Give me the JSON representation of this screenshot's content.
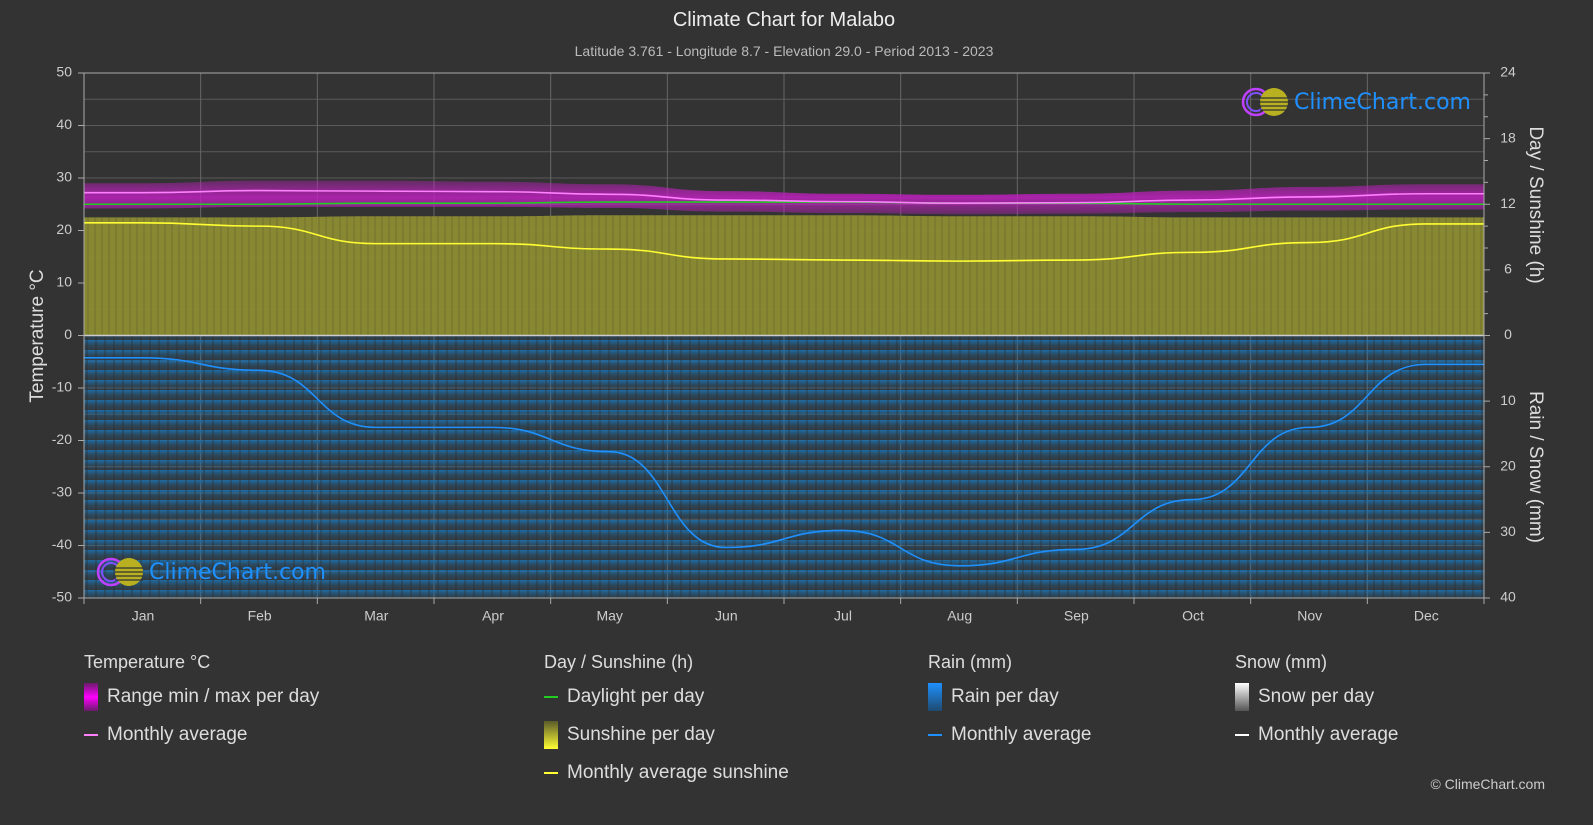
{
  "header": {
    "title": "Climate Chart for Malabo",
    "subtitle": "Latitude 3.761 - Longitude 8.7 - Elevation 29.0 - Period 2013 - 2023"
  },
  "logo": {
    "text": "ClimeChart.com"
  },
  "copyright": "© ClimeChart.com",
  "colors": {
    "background": "#333333",
    "temp_range": "#c020c0",
    "temp_avg": "#ff80ff",
    "daylight": "#22cc22",
    "sunshine_fill": "#8c8c33",
    "sunshine_avg": "#ffff33",
    "rain_fill": "#1e6ea8",
    "rain_avg": "#1e90ff",
    "snow_avg": "#ffffff",
    "brand": "#1e90ff"
  },
  "legend": {
    "temperature": {
      "title": "Temperature °C",
      "items": [
        {
          "label": "Range min / max per day",
          "icon": "range-swatch"
        },
        {
          "label": "Monthly average",
          "icon": "line-swatch"
        }
      ]
    },
    "sunshine": {
      "title": "Day / Sunshine (h)",
      "items": [
        {
          "label": "Daylight per day",
          "icon": "line-swatch"
        },
        {
          "label": "Sunshine per day",
          "icon": "bar-swatch"
        },
        {
          "label": "Monthly average sunshine",
          "icon": "line-swatch"
        }
      ]
    },
    "rain": {
      "title": "Rain (mm)",
      "items": [
        {
          "label": "Rain per day",
          "icon": "bar-swatch"
        },
        {
          "label": "Monthly average",
          "icon": "line-swatch"
        }
      ]
    },
    "snow": {
      "title": "Snow (mm)",
      "items": [
        {
          "label": "Snow per day",
          "icon": "bar-swatch"
        },
        {
          "label": "Monthly average",
          "icon": "line-swatch"
        }
      ]
    }
  },
  "chart_data": {
    "type": "line",
    "title": "Climate Chart for Malabo",
    "categories": [
      "Jan",
      "Feb",
      "Mar",
      "Apr",
      "May",
      "Jun",
      "Jul",
      "Aug",
      "Sep",
      "Oct",
      "Nov",
      "Dec"
    ],
    "axes": {
      "left": {
        "label": "Temperature °C",
        "range": [
          -50,
          50
        ],
        "ticks": [
          50,
          40,
          30,
          20,
          10,
          0,
          -10,
          -20,
          -30,
          -40,
          -50
        ]
      },
      "right_top": {
        "label": "Day / Sunshine (h)",
        "range": [
          0,
          24
        ],
        "ticks": [
          24,
          18,
          12,
          6,
          0
        ]
      },
      "right_bottom": {
        "label": "Rain / Snow (mm)",
        "range": [
          0,
          40
        ],
        "ticks": [
          0,
          10,
          20,
          30,
          40
        ],
        "inverted": true
      }
    },
    "grid": true,
    "series": [
      {
        "name": "Temperature monthly average",
        "unit": "°C",
        "axis": "left",
        "values": [
          27.2,
          27.6,
          27.5,
          27.4,
          26.9,
          25.8,
          25.5,
          25.2,
          25.3,
          25.8,
          26.4,
          27.0
        ]
      },
      {
        "name": "Temperature daily max (approx.)",
        "unit": "°C",
        "axis": "left",
        "values": [
          29.0,
          29.5,
          29.5,
          29.3,
          28.8,
          27.5,
          27.0,
          26.8,
          27.0,
          27.6,
          28.3,
          28.8
        ]
      },
      {
        "name": "Temperature daily min (approx.)",
        "unit": "°C",
        "axis": "left",
        "values": [
          24.2,
          24.5,
          24.5,
          24.5,
          24.3,
          23.6,
          23.3,
          23.1,
          23.2,
          23.5,
          23.8,
          24.0
        ]
      },
      {
        "name": "Daylight per day",
        "unit": "h",
        "axis": "right_top",
        "values": [
          12.0,
          12.0,
          12.1,
          12.1,
          12.2,
          12.2,
          12.2,
          12.1,
          12.1,
          12.0,
          12.0,
          12.0
        ]
      },
      {
        "name": "Monthly average sunshine",
        "unit": "h",
        "axis": "right_top",
        "values": [
          10.3,
          10.0,
          8.4,
          8.4,
          7.9,
          7.0,
          6.9,
          6.8,
          6.9,
          7.6,
          8.5,
          10.2
        ]
      },
      {
        "name": "Rain monthly average",
        "unit": "mm",
        "axis": "right_bottom",
        "values": [
          3.4,
          5.3,
          14.0,
          14.0,
          17.7,
          32.3,
          29.7,
          35.1,
          32.6,
          25.0,
          14.0,
          4.4
        ]
      },
      {
        "name": "Snow monthly average",
        "unit": "mm",
        "axis": "right_bottom",
        "values": [
          0,
          0,
          0,
          0,
          0,
          0,
          0,
          0,
          0,
          0,
          0,
          0
        ]
      }
    ]
  }
}
